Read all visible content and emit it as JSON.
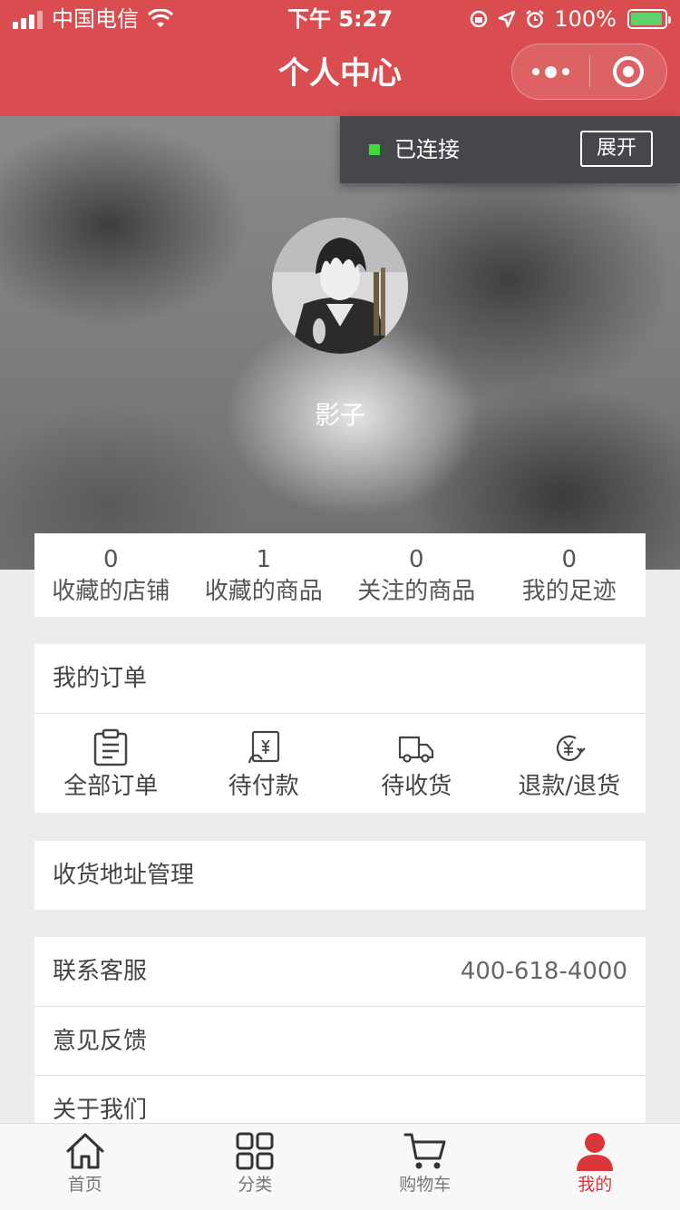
{
  "status_bar": {
    "carrier": "中国电信",
    "time": "下午 5:27",
    "battery": "100%"
  },
  "nav": {
    "title": "个人中心"
  },
  "connection": {
    "status": "已连接",
    "expand_label": "展开"
  },
  "profile": {
    "username": "影子"
  },
  "stats": [
    {
      "value": "0",
      "label": "收藏的店铺"
    },
    {
      "value": "1",
      "label": "收藏的商品"
    },
    {
      "value": "0",
      "label": "关注的商品"
    },
    {
      "value": "0",
      "label": "我的足迹"
    }
  ],
  "orders": {
    "title": "我的订单",
    "items": [
      {
        "label": "全部订单",
        "icon": "clipboard-icon"
      },
      {
        "label": "待付款",
        "icon": "payment-icon"
      },
      {
        "label": "待收货",
        "icon": "truck-icon"
      },
      {
        "label": "退款/退货",
        "icon": "refund-icon"
      }
    ]
  },
  "address": {
    "label": "收货地址管理"
  },
  "menu": [
    {
      "label": "联系客服",
      "value": "400-618-4000"
    },
    {
      "label": "意见反馈"
    },
    {
      "label": "关于我们"
    }
  ],
  "tabbar": [
    {
      "label": "首页",
      "icon": "home-icon"
    },
    {
      "label": "分类",
      "icon": "grid-icon"
    },
    {
      "label": "购物车",
      "icon": "cart-icon"
    },
    {
      "label": "我的",
      "icon": "user-icon",
      "active": true
    }
  ],
  "colors": {
    "primary": "#d94d50",
    "tab_active": "#d9373a",
    "connected": "#3ddc3d"
  }
}
